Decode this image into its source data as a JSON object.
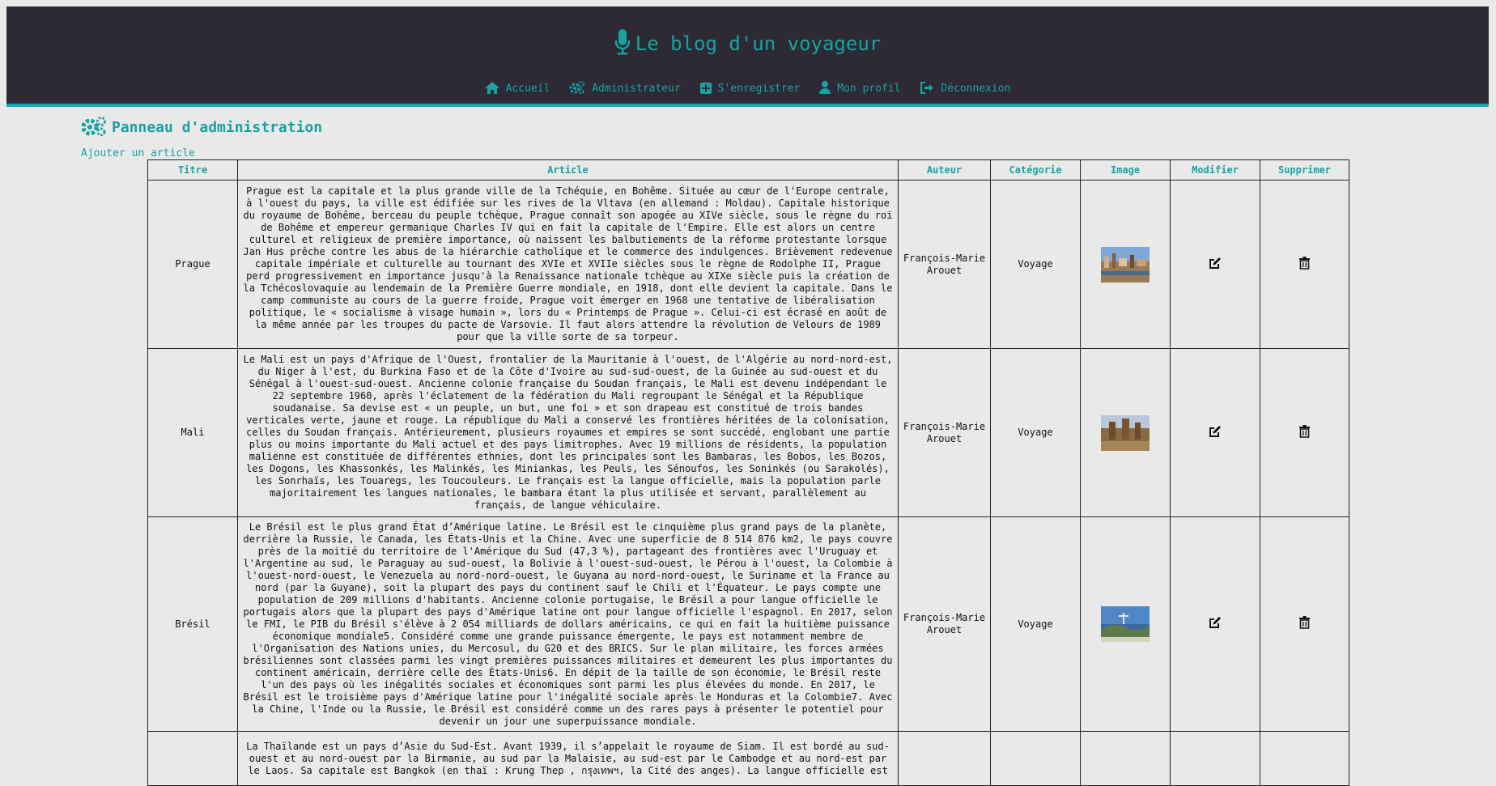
{
  "header": {
    "title": "Le blog d'un voyageur",
    "nav": [
      {
        "label": "Accueil",
        "icon": "home-icon"
      },
      {
        "label": "Administrateur",
        "icon": "cogs-icon"
      },
      {
        "label": "S'enregistrer",
        "icon": "plus-square-icon"
      },
      {
        "label": "Mon profil",
        "icon": "user-icon"
      },
      {
        "label": "Déconnexion",
        "icon": "sign-out-icon"
      }
    ]
  },
  "admin": {
    "title": "Panneau d'administration",
    "add_article": "Ajouter un article"
  },
  "table": {
    "headers": [
      "Titre",
      "Article",
      "Auteur",
      "Catégorie",
      "Image",
      "Modifier",
      "Supprimer"
    ],
    "rows": [
      {
        "title": "Prague",
        "article": "Prague est la capitale et la plus grande ville de la Tchéquie, en Bohême. Située au cœur de l'Europe centrale, à l'ouest du pays, la ville est édifiée sur les rives de la Vltava (en allemand : Moldau). Capitale historique du royaume de Bohême, berceau du peuple tchèque, Prague connaît son apogée au XIVe siècle, sous le règne du roi de Bohême et empereur germanique Charles IV qui en fait la capitale de l'Empire. Elle est alors un centre culturel et religieux de première importance, où naissent les balbutiements de la réforme protestante lorsque Jan Hus prêche contre les abus de la hiérarchie catholique et le commerce des indulgences. Brièvement redevenue capitale impériale et culturelle au tournant des XVIe et XVIIe siècles sous le règne de Rodolphe II, Prague perd progressivement en importance jusqu'à la Renaissance nationale tchèque au XIXe siècle puis la création de la Tchécoslovaquie au lendemain de la Première Guerre mondiale, en 1918, dont elle devient la capitale. Dans le camp communiste au cours de la guerre froide, Prague voit émerger en 1968 une tentative de libéralisation politique, le « socialisme à visage humain », lors du « Printemps de Prague ». Celui-ci est écrasé en août de la même année par les troupes du pacte de Varsovie. Il faut alors attendre la révolution de Velours de 1989 pour que la ville sorte de sa torpeur.",
        "author": "François-Marie Arouet",
        "category": "Voyage"
      },
      {
        "title": "Mali",
        "article": "Le Mali est un pays d'Afrique de l'Ouest, frontalier de la Mauritanie à l'ouest, de l'Algérie au nord-nord-est, du Niger à l'est, du Burkina Faso et de la Côte d'Ivoire au sud-sud-ouest, de la Guinée au sud-ouest et du Sénégal à l'ouest-sud-ouest. Ancienne colonie française du Soudan français, le Mali est devenu indépendant le 22 septembre 1960, après l'éclatement de la fédération du Mali regroupant le Sénégal et la République soudanaise. Sa devise est « un peuple, un but, une foi » et son drapeau est constitué de trois bandes verticales verte, jaune et rouge. La république du Mali a conservé les frontières héritées de la colonisation, celles du Soudan français. Antérieurement, plusieurs royaumes et empires se sont succédé, englobant une partie plus ou moins importante du Mali actuel et des pays limitrophes. Avec 19 millions de résidents, la population malienne est constituée de différentes ethnies, dont les principales sont les Bambaras, les Bobos, les Bozos, les Dogons, les Khassonkés, les Malinkés, les Miniankas, les Peuls, les Sénoufos, les Soninkés (ou Sarakolés), les Sonrhaïs, les Touaregs, les Toucouleurs. Le français est la langue officielle, mais la population parle majoritairement les langues nationales, le bambara étant la plus utilisée et servant, parallèlement au français, de langue véhiculaire.",
        "author": "François-Marie Arouet",
        "category": "Voyage"
      },
      {
        "title": "Brésil",
        "article": "Le Brésil est le plus grand État d’Amérique latine. Le Brésil est le cinquième plus grand pays de la planète, derrière la Russie, le Canada, les États-Unis et la Chine. Avec une superficie de 8 514 876 km2, le pays couvre près de la moitié du territoire de l'Amérique du Sud (47,3 %), partageant des frontières avec l'Uruguay et l'Argentine au sud, le Paraguay au sud-ouest, la Bolivie à l'ouest-sud-ouest, le Pérou à l'ouest, la Colombie à l'ouest-nord-ouest, le Venezuela au nord-nord-ouest, le Guyana au nord-nord-ouest, le Suriname et la France au nord (par la Guyane), soit la plupart des pays du continent sauf le Chili et l'Équateur. Le pays compte une population de 209 millions d'habitants. Ancienne colonie portugaise, le Brésil a pour langue officielle le portugais alors que la plupart des pays d'Amérique latine ont pour langue officielle l'espagnol. En 2017, selon le FMI, le PIB du Brésil s'élève à 2 054 milliards de dollars américains, ce qui en fait la huitième puissance économique mondiale5. Considéré comme une grande puissance émergente, le pays est notamment membre de l'Organisation des Nations unies, du Mercosul, du G20 et des BRICS. Sur le plan militaire, les forces armées brésiliennes sont classées parmi les vingt premières puissances militaires et demeurent les plus importantes du continent américain, derrière celle des États-Unis6. En dépit de la taille de son économie, le Brésil reste l'un des pays où les inégalités sociales et économiques sont parmi les plus élevées du monde. En 2017, le Brésil est le troisième pays d'Amérique latine pour l'inégalité sociale après le Honduras et la Colombie7. Avec la Chine, l'Inde ou la Russie, le Brésil est considéré comme un des rares pays à présenter le potentiel pour devenir un jour une superpuissance mondiale.",
        "author": "François-Marie Arouet",
        "category": "Voyage"
      },
      {
        "title": "",
        "article": "La Thaïlande est un pays d’Asie du Sud-Est. Avant 1939, il s’appelait le royaume de Siam. Il est bordé au sud-ouest et au nord-ouest par la Birmanie, au sud par la Malaisie, au sud-est par le Cambodge et au nord-est par le Laos. Sa capitale est Bangkok (en thaï : Krung Thep , กรุงเทพฯ, la Cité des anges). La langue officielle est",
        "author": "",
        "category": ""
      }
    ]
  }
}
